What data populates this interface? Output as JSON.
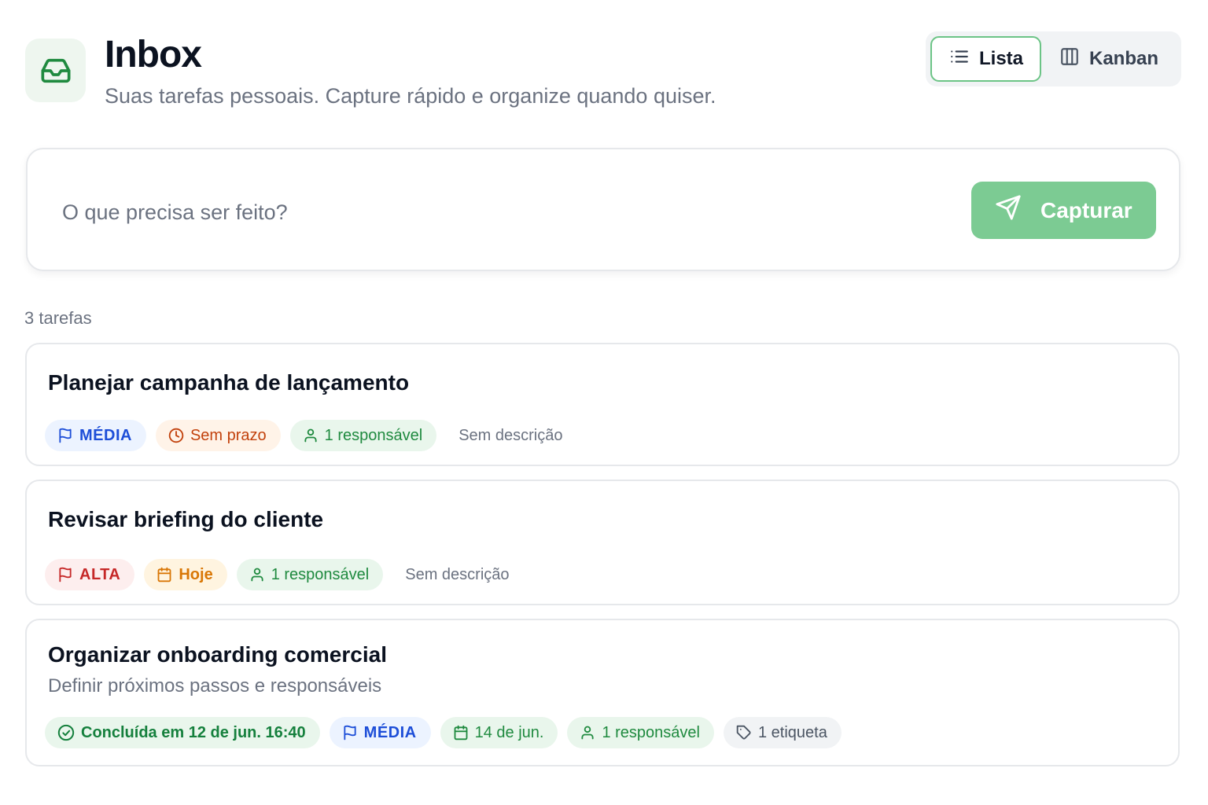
{
  "header": {
    "title": "Inbox",
    "subtitle": "Suas tarefas pessoais. Capture rápido e organize quando quiser.",
    "icon": "inbox-icon"
  },
  "view_toggle": {
    "lista_label": "Lista",
    "kanban_label": "Kanban",
    "active": "Lista"
  },
  "capture": {
    "placeholder": "O que precisa ser feito?",
    "value": "",
    "button_label": "Capturar"
  },
  "task_count": "3 tarefas",
  "tasks": [
    {
      "title": "Planejar campanha de lançamento",
      "description": "",
      "priority": "MÉDIA",
      "due": "Sem prazo",
      "assignees": "1 responsável",
      "no_description_label": "Sem descrição"
    },
    {
      "title": "Revisar briefing do cliente",
      "description": "",
      "priority": "ALTA",
      "due": "Hoje",
      "assignees": "1 responsável",
      "no_description_label": "Sem descrição"
    },
    {
      "title": "Organizar onboarding comercial",
      "description": "Definir próximos passos e responsáveis",
      "completed": "Concluída em 12 de jun. 16:40",
      "priority": "MÉDIA",
      "due": "14 de jun.",
      "assignees": "1 responsável",
      "tags": "1 etiqueta"
    }
  ],
  "colors": {
    "accent": "#7ccb93",
    "accent_border": "#6cc486",
    "priority_media": "#1d4ed8",
    "priority_alta": "#c62828",
    "due_none": "#c2410c",
    "due_today": "#d97706",
    "success": "#1f8a3f"
  }
}
